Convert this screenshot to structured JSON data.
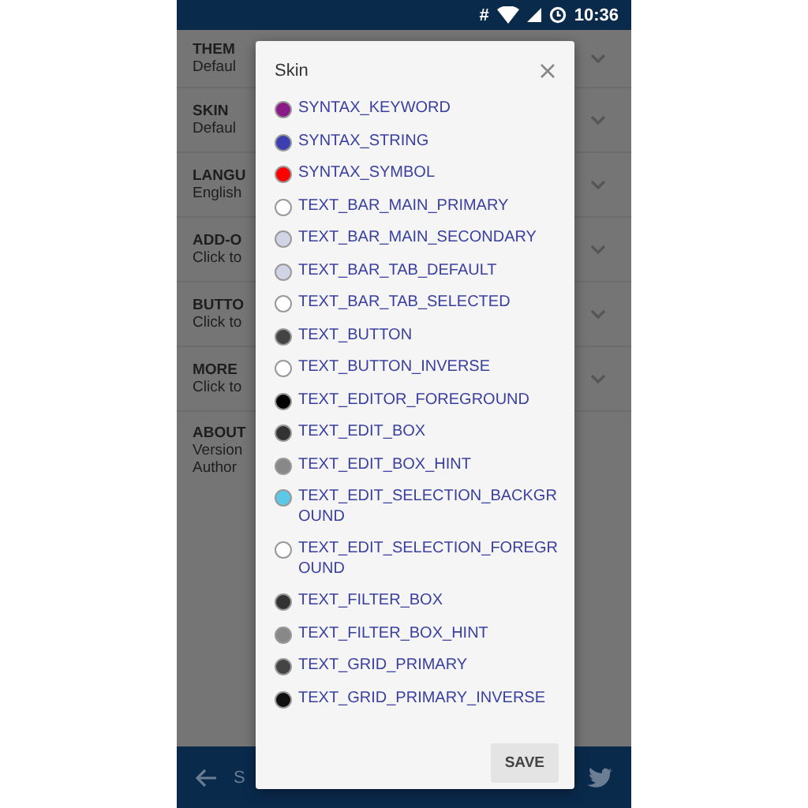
{
  "status_bar": {
    "icon_text": "#",
    "time": "10:36"
  },
  "settings": [
    {
      "title": "THEM",
      "subtitle": [
        "Defaul"
      ]
    },
    {
      "title": "SKIN",
      "subtitle": [
        "Defaul"
      ]
    },
    {
      "title": "LANGU",
      "subtitle": [
        "English"
      ]
    },
    {
      "title": "ADD-O",
      "subtitle": [
        "Click to"
      ]
    },
    {
      "title": "BUTTO",
      "subtitle": [
        "Click to"
      ]
    },
    {
      "title": "MORE",
      "subtitle": [
        "Click to"
      ]
    },
    {
      "title": "ABOUT",
      "subtitle": [
        "Version",
        "Author"
      ]
    }
  ],
  "dialog": {
    "title": "Skin",
    "items": [
      {
        "label": "SYNTAX_KEYWORD",
        "color": "#8b1a89"
      },
      {
        "label": "SYNTAX_STRING",
        "color": "#3b3fb0"
      },
      {
        "label": "SYNTAX_SYMBOL",
        "color": "#ff0000"
      },
      {
        "label": "TEXT_BAR_MAIN_PRIMARY",
        "color": "#ffffff"
      },
      {
        "label": "TEXT_BAR_MAIN_SECONDARY",
        "color": "#d0d4e4"
      },
      {
        "label": "TEXT_BAR_TAB_DEFAULT",
        "color": "#d0d4e4"
      },
      {
        "label": "TEXT_BAR_TAB_SELECTED",
        "color": "#ffffff"
      },
      {
        "label": "TEXT_BUTTON",
        "color": "#444444"
      },
      {
        "label": "TEXT_BUTTON_INVERSE",
        "color": "#ffffff"
      },
      {
        "label": "TEXT_EDITOR_FOREGROUND",
        "color": "#000000"
      },
      {
        "label": "TEXT_EDIT_BOX",
        "color": "#333333"
      },
      {
        "label": "TEXT_EDIT_BOX_HINT",
        "color": "#888888"
      },
      {
        "label": "TEXT_EDIT_SELECTION_BACKGROUND",
        "color": "#5bc8e8"
      },
      {
        "label": "TEXT_EDIT_SELECTION_FOREGROUND",
        "color": "#ffffff"
      },
      {
        "label": "TEXT_FILTER_BOX",
        "color": "#333333"
      },
      {
        "label": "TEXT_FILTER_BOX_HINT",
        "color": "#888888"
      },
      {
        "label": "TEXT_GRID_PRIMARY",
        "color": "#444444"
      },
      {
        "label": "TEXT_GRID_PRIMARY_INVERSE",
        "color": "#111111"
      }
    ],
    "button": "SAVE"
  },
  "bottom_bar": {
    "label": "S"
  }
}
